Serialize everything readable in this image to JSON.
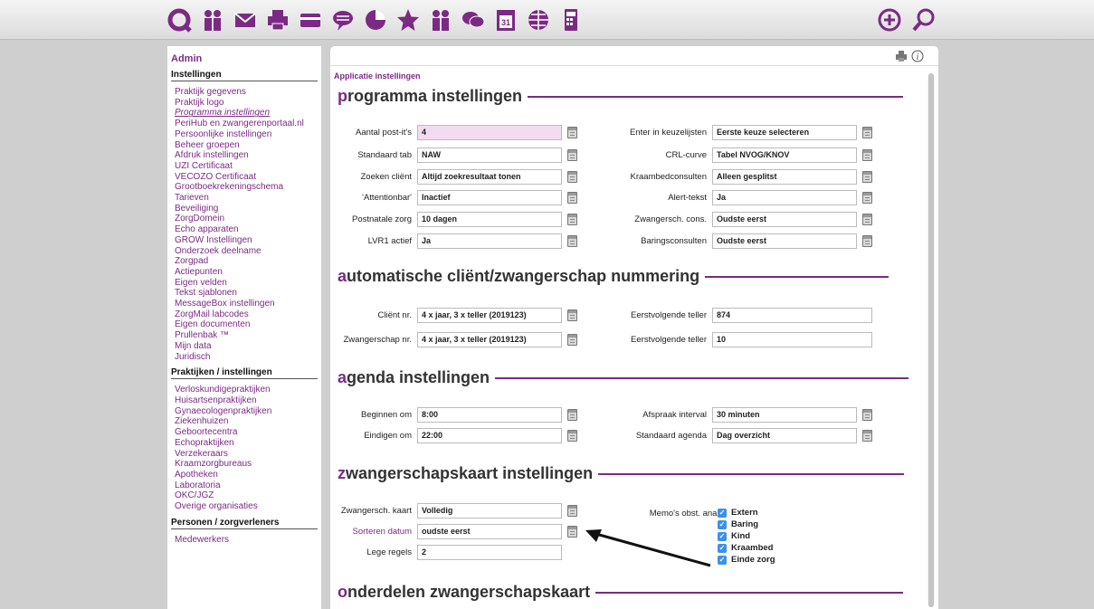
{
  "sidebar": {
    "admin": "Admin",
    "sections": [
      {
        "title": "Instellingen",
        "items": [
          "Praktijk gegevens",
          "Praktijk logo",
          "Programma instellingen",
          "PeriHub en zwangerenportaal.nl",
          "Persoonlijke instellingen",
          "Beheer groepen",
          "Afdruk instellingen",
          "UZI Certificaat",
          "VECOZO Certificaat",
          "Grootboekrekeningschema",
          "Tarieven",
          "Beveiliging",
          "ZorgDomein",
          "Echo apparaten",
          "GROW Instellingen",
          "Onderzoek deelname",
          "Zorgpad",
          "Actiepunten",
          "Eigen velden",
          "Tekst sjablonen",
          "MessageBox instellingen",
          "ZorgMail labcodes",
          "Eigen documenten",
          "Prullenbak ™",
          "Mijn data",
          "Juridisch"
        ]
      },
      {
        "title": "Praktijken / instellingen",
        "items": [
          "Verloskundigepraktijken",
          "Huisartsenpraktijken",
          "Gynaecologenpraktijken",
          "Ziekenhuizen",
          "Geboortecentra",
          "Echopraktijken",
          "Verzekeraars",
          "Kraamzorgbureaus",
          "Apotheken",
          "Laboratoria",
          "OKC/JGZ",
          "Overige organisaties"
        ]
      },
      {
        "title": "Personen / zorgverleners",
        "items": [
          "Medewerkers"
        ]
      }
    ]
  },
  "breadcrumb": "Applicatie instellingen",
  "sections": {
    "s1": {
      "first": "p",
      "rest": "rogramma instellingen"
    },
    "s2": {
      "first": "a",
      "rest": "utomatische cliënt/zwangerschap nummering"
    },
    "s3": {
      "first": "a",
      "rest": "genda instellingen"
    },
    "s4": {
      "first": "z",
      "rest": "wangerschapskaart instellingen"
    },
    "s5": {
      "first": "o",
      "rest": "nderdelen zwangerschapskaart"
    }
  },
  "prog": {
    "left": [
      {
        "label": "Aantal post-it's",
        "value": "4"
      },
      {
        "label": "Standaard tab",
        "value": "NAW"
      },
      {
        "label": "Zoeken cliënt",
        "value": "Altijd zoekresultaat tonen"
      },
      {
        "label": "'Attentionbar'",
        "value": "Inactief"
      },
      {
        "label": "Postnatale zorg",
        "value": "10 dagen"
      },
      {
        "label": "LVR1 actief",
        "value": "Ja"
      }
    ],
    "right": [
      {
        "label": "Enter in keuzelijsten",
        "value": "Eerste keuze selecteren"
      },
      {
        "label": "CRL-curve",
        "value": "Tabel NVOG/KNOV"
      },
      {
        "label": "Kraambedconsulten",
        "value": "Alleen gesplitst"
      },
      {
        "label": "Alert-tekst",
        "value": "Ja"
      },
      {
        "label": "Zwangersch. cons.",
        "value": "Oudste eerst"
      },
      {
        "label": "Baringsconsulten",
        "value": "Oudste eerst"
      }
    ]
  },
  "num": {
    "left": [
      {
        "label": "Cliënt nr.",
        "value": "4 x jaar, 3 x teller (2019123)"
      },
      {
        "label": "Zwangerschap nr.",
        "value": "4 x jaar, 3 x teller (2019123)"
      }
    ],
    "right": [
      {
        "label": "Eerstvolgende teller",
        "value": "874"
      },
      {
        "label": "Eerstvolgende teller",
        "value": "10"
      }
    ]
  },
  "agenda": {
    "left": [
      {
        "label": "Beginnen om",
        "value": "8:00"
      },
      {
        "label": "Eindigen om",
        "value": "22:00"
      }
    ],
    "right": [
      {
        "label": "Afspraak interval",
        "value": "30 minuten"
      },
      {
        "label": "Standaard agenda",
        "value": "Dag overzicht"
      }
    ]
  },
  "kaart": {
    "left": [
      {
        "label": "Zwangersch. kaart",
        "value": "Volledig"
      },
      {
        "label": "Sorteren datum",
        "value": "oudste eerst"
      },
      {
        "label": "Lege regels",
        "value": "2"
      }
    ],
    "memo_label": "Memo's obst. anam.",
    "memo_options": [
      "Extern",
      "Baring",
      "Kind",
      "Kraambed",
      "Einde zorg"
    ]
  },
  "colors": {
    "accent": "#7b2a83",
    "checkbox": "#3b8ff0",
    "highlight": "#f3dcef"
  }
}
